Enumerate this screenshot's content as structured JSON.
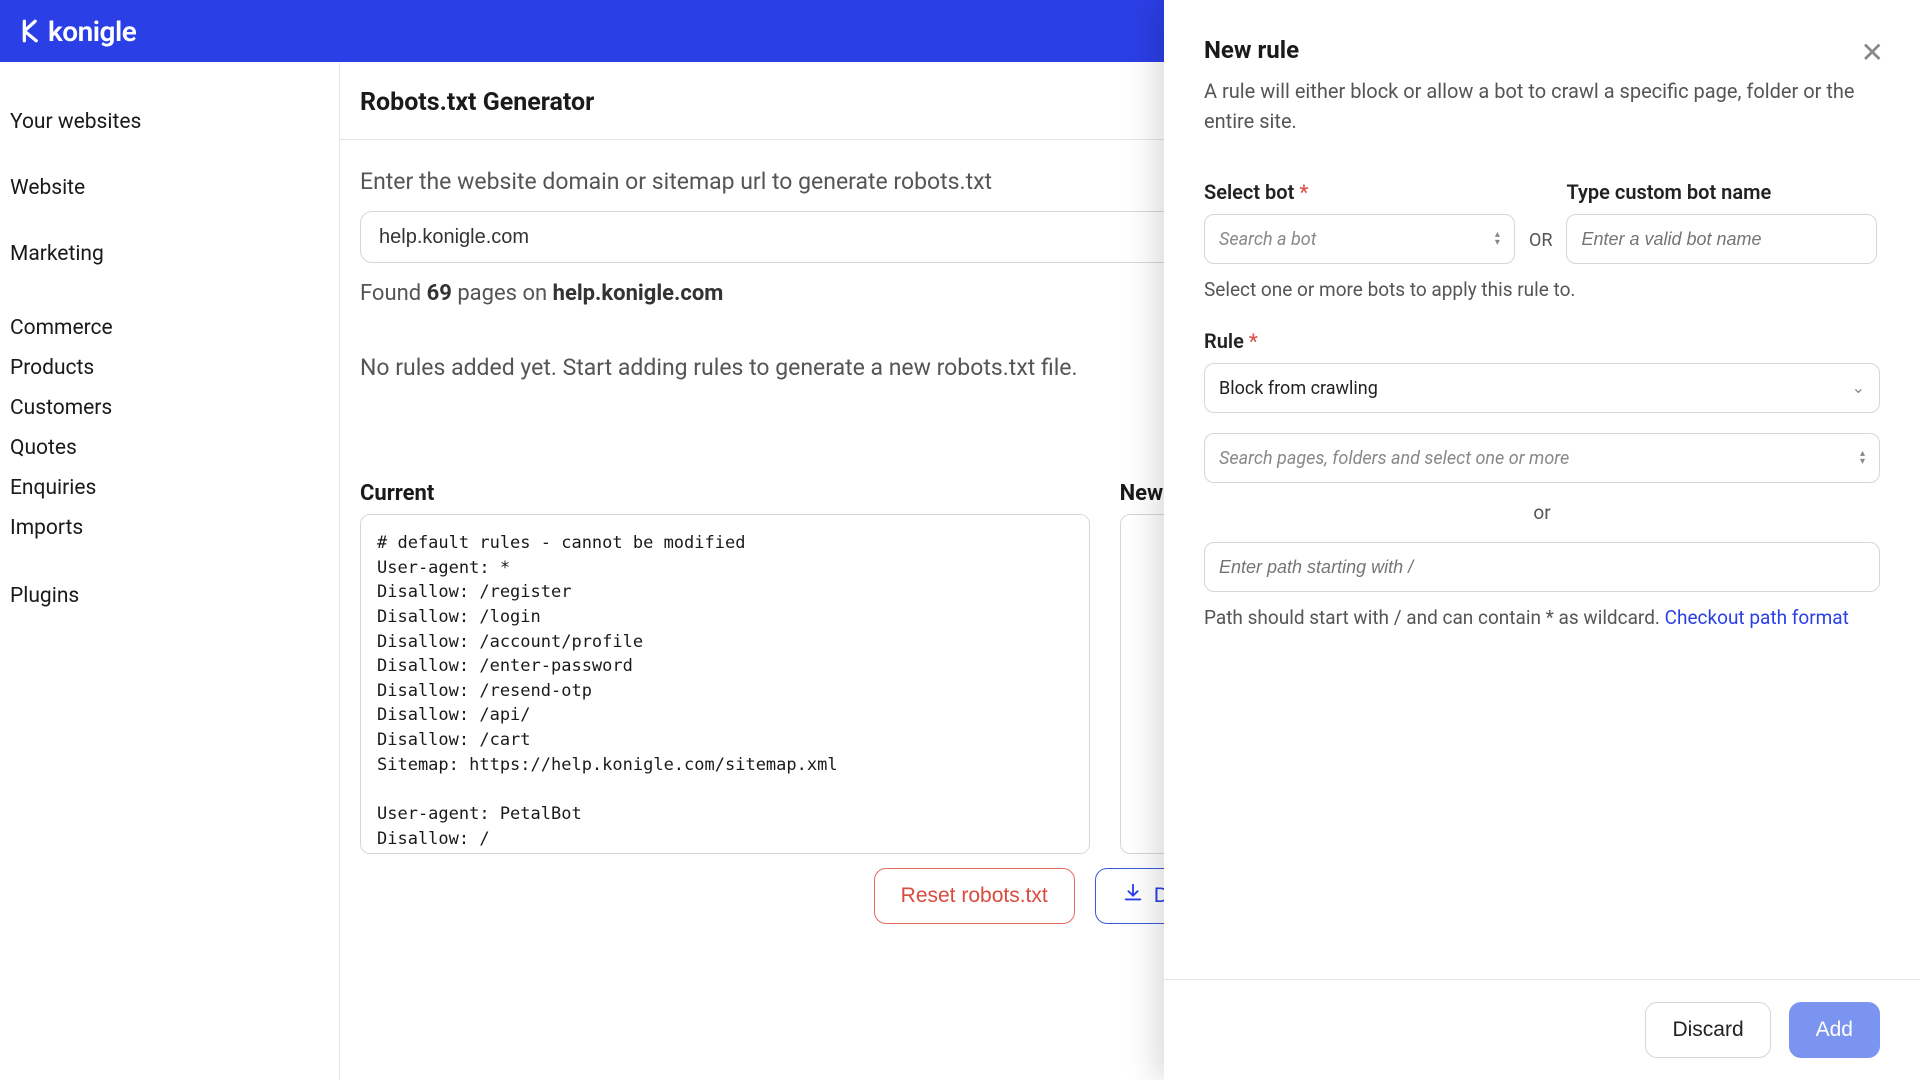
{
  "brand": "konigle",
  "sidebar": {
    "items": [
      {
        "label": "Your websites"
      },
      {
        "label": "Website"
      },
      {
        "label": "Marketing"
      },
      {
        "label": "Commerce"
      },
      {
        "label": "Products"
      },
      {
        "label": "Customers"
      },
      {
        "label": "Quotes"
      },
      {
        "label": "Enquiries"
      },
      {
        "label": "Imports"
      },
      {
        "label": "Plugins"
      }
    ]
  },
  "page": {
    "title": "Robots.txt Generator",
    "intro": "Enter the website domain or sitemap url to generate robots.txt",
    "domain_value": "help.konigle.com",
    "found_prefix": "Found ",
    "found_count": "69",
    "found_mid": " pages on ",
    "found_domain": "help.konigle.com",
    "empty_rules": "No rules added yet. Start adding rules to generate a new robots.txt file.",
    "current_heading": "Current",
    "new_heading": "New",
    "current_text": "# default rules - cannot be modified\nUser-agent: *\nDisallow: /register\nDisallow: /login\nDisallow: /account/profile\nDisallow: /enter-password\nDisallow: /resend-otp\nDisallow: /api/\nDisallow: /cart\nSitemap: https://help.konigle.com/sitemap.xml\n\nUser-agent: PetalBot\nDisallow: /\n# end of default rules",
    "reset_label": "Reset robots.txt",
    "download_label": "Download robots.txt"
  },
  "drawer": {
    "title": "New rule",
    "subtitle": "A rule will either block or allow a bot to crawl a specific page, folder or the entire site.",
    "select_bot_label": "Select bot ",
    "select_bot_placeholder": "Search a bot",
    "or": "OR",
    "custom_bot_label": "Type custom bot name",
    "custom_bot_placeholder": "Enter a valid bot name",
    "bot_helper": "Select one or more bots to apply this rule to.",
    "rule_label": "Rule ",
    "rule_value": "Block from crawling",
    "pages_placeholder": "Search pages, folders and select one or more",
    "or_center": "or",
    "path_placeholder": "Enter path starting with /",
    "path_help_text": "Path should start with / and can contain * as wildcard. ",
    "path_help_link": "Checkout path format",
    "discard": "Discard",
    "add": "Add"
  }
}
